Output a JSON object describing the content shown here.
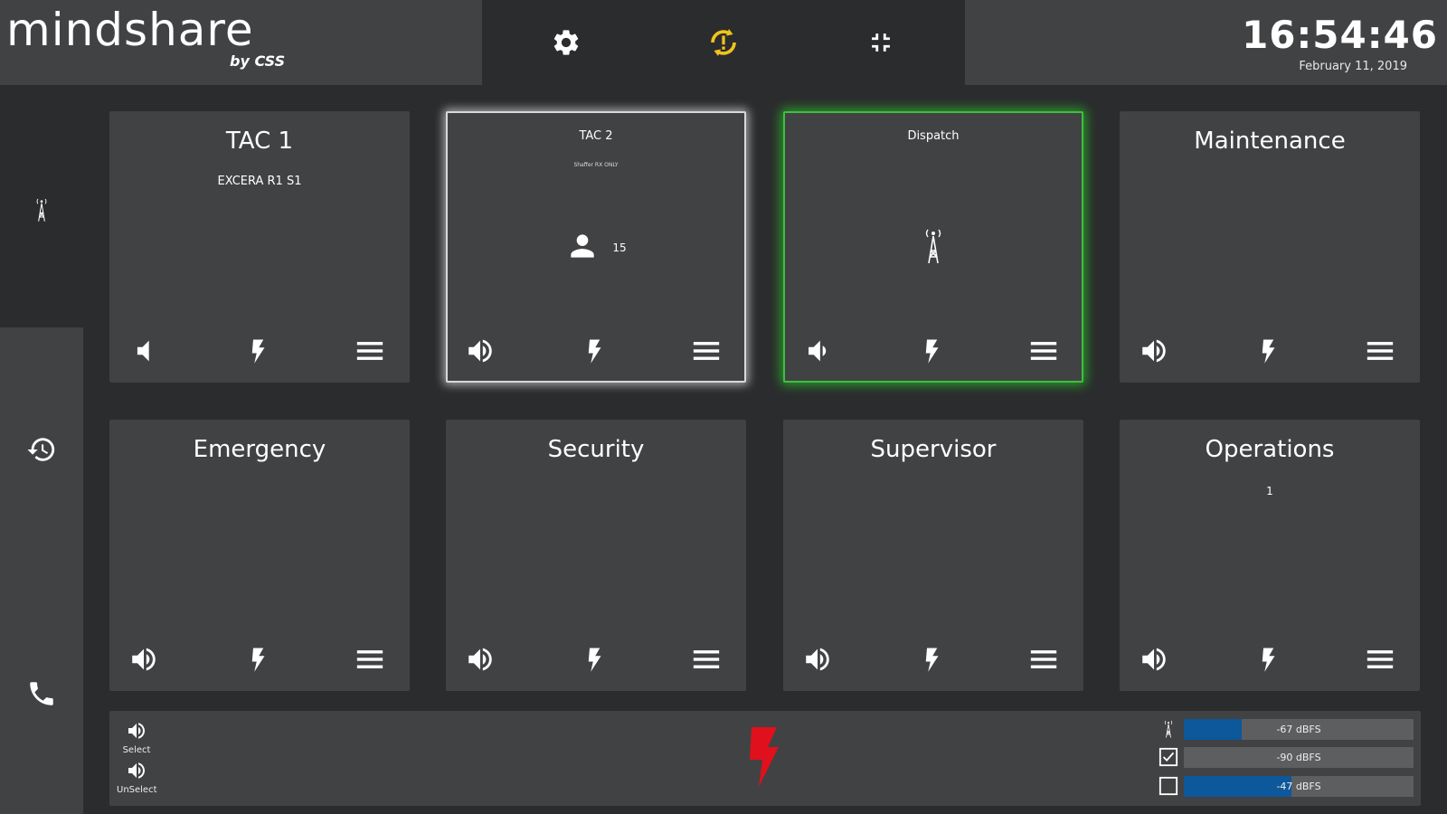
{
  "header": {
    "logo_main": "mindshare",
    "logo_sub": "by CSS",
    "time": "16:54:46",
    "date": "February 11, 2019",
    "icons": [
      "gear-icon",
      "sync-alert-icon",
      "collapse-icon"
    ],
    "accent_color": "#f0c419"
  },
  "sidebar": {
    "icons": [
      "radio-tower-icon",
      "history-icon",
      "phone-icon"
    ]
  },
  "tiles": [
    {
      "title": "TAC 1",
      "subtitle": "EXCERA R1 S1",
      "state": "muted"
    },
    {
      "title": "TAC 2",
      "subtitle": "Shaffer RX ONLY",
      "count": "15",
      "state": "selected"
    },
    {
      "title": "Dispatch",
      "state": "transmitting"
    },
    {
      "title": "Maintenance",
      "state": "normal"
    },
    {
      "title": "Emergency",
      "state": "normal"
    },
    {
      "title": "Security",
      "state": "normal"
    },
    {
      "title": "Supervisor",
      "state": "normal"
    },
    {
      "title": "Operations",
      "subtitle": "1",
      "state": "normal"
    }
  ],
  "bottom": {
    "select_label": "Select",
    "unselect_label": "UnSelect",
    "emergency_color": "#e0101c",
    "meters": [
      {
        "icon": "radio-tower-icon",
        "label": "-67 dBFS",
        "level": 0.25
      },
      {
        "icon": "checkbox-checked-icon",
        "label": "-90 dBFS",
        "level": 0.0
      },
      {
        "icon": "checkbox-empty-icon",
        "label": "-47 dBFS",
        "level": 0.47
      }
    ]
  }
}
